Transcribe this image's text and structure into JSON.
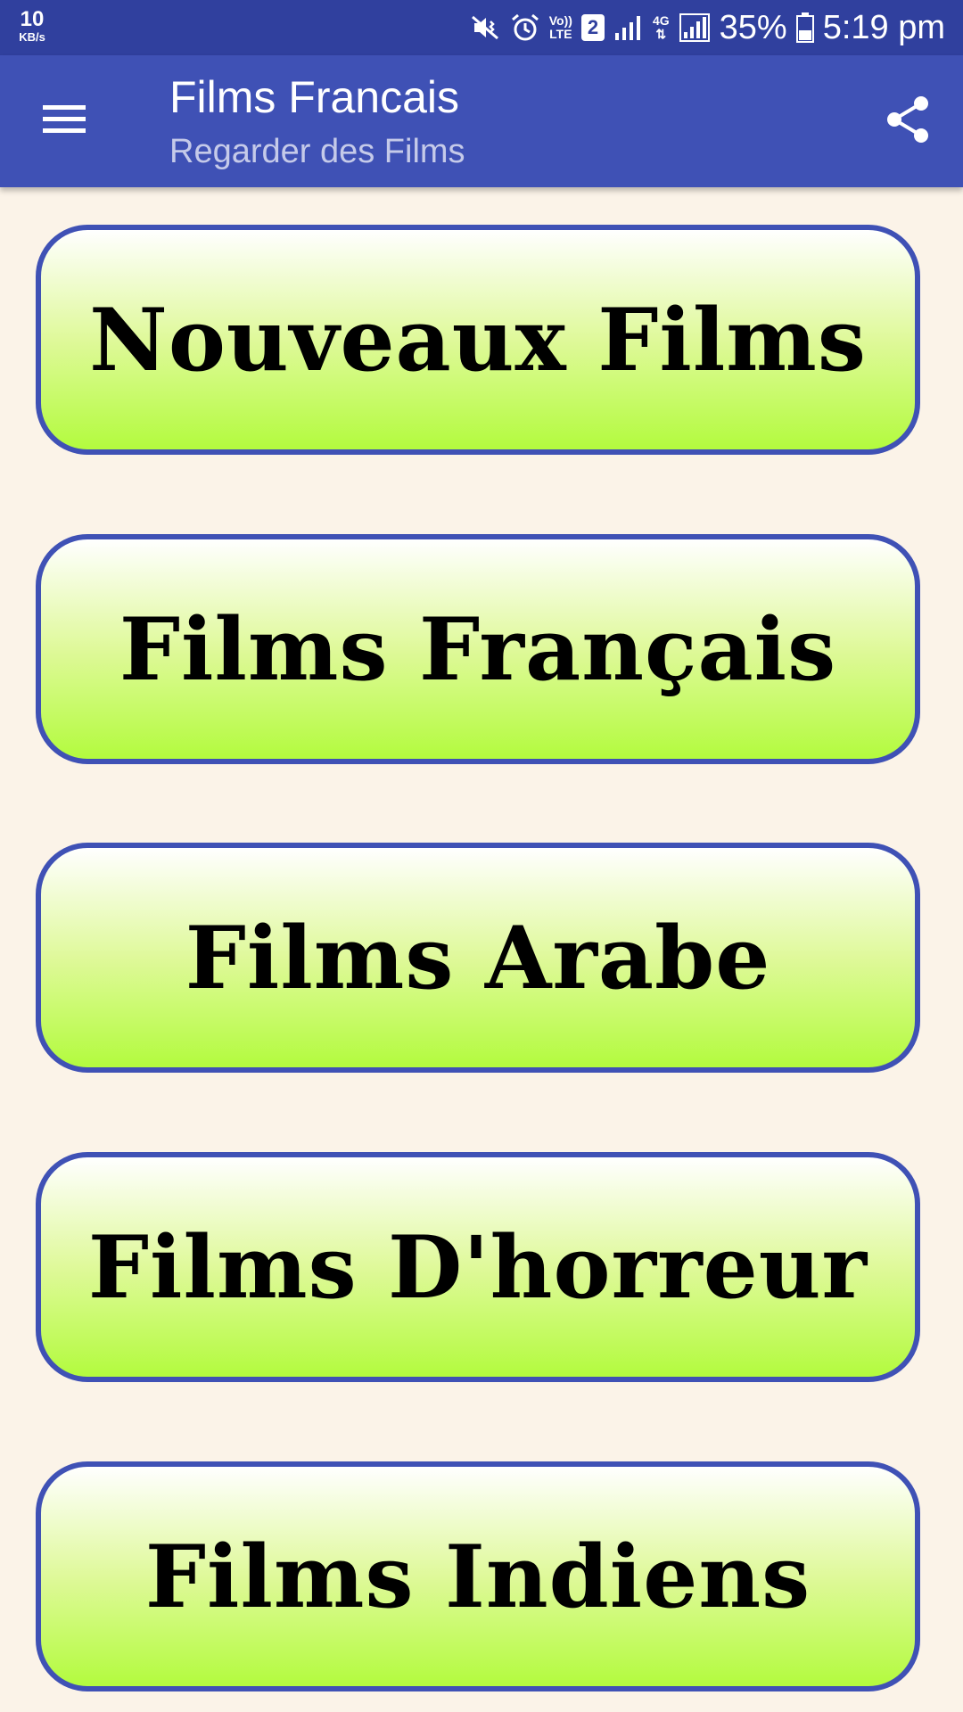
{
  "status_bar": {
    "net_speed_value": "10",
    "net_speed_unit": "KB/s",
    "volte_top": "Vo))",
    "volte_bottom": "LTE",
    "sim_slot": "2",
    "network_type": "4G",
    "battery_percent": "35%",
    "time": "5:19 pm"
  },
  "app_bar": {
    "title": "Films Francais",
    "subtitle": "Regarder des Films"
  },
  "categories": [
    {
      "label": "Nouveaux Films"
    },
    {
      "label": "Films Français"
    },
    {
      "label": "Films Arabe"
    },
    {
      "label": "Films D'horreur"
    },
    {
      "label": "Films Indiens"
    }
  ],
  "colors": {
    "status_bar": "#30409e",
    "app_bar": "#3f51b5",
    "background": "#fbf3e8",
    "button_border": "#3f51b5",
    "button_gradient_top": "#ffffff",
    "button_gradient_bottom": "#b3fb3e"
  },
  "icons": {
    "menu": "hamburger-menu-icon",
    "share": "share-icon",
    "mute": "vibrate-mute-icon",
    "alarm": "alarm-icon",
    "signal": "signal-icon",
    "battery": "battery-icon"
  }
}
